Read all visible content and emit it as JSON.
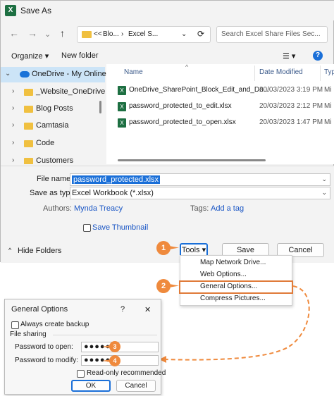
{
  "window": {
    "title": "Save As",
    "app_icon": "excel-icon"
  },
  "nav": {
    "back": "←",
    "forward": "→",
    "recent": "⌄",
    "up": "↑",
    "address": {
      "prefix": "<<",
      "crumb1": "Blo...",
      "sep": "›",
      "crumb2": "Excel S...",
      "chev": "⌄",
      "refresh": "⟳"
    },
    "search_placeholder": "Search Excel Share Files Sec..."
  },
  "toolbar": {
    "organize": "Organize ▾",
    "new_folder": "New folder",
    "view": "☰ ▾",
    "help": "?"
  },
  "sidebar": {
    "items": [
      {
        "label": "OneDrive - My Online",
        "chev": "⌄",
        "selected": true
      },
      {
        "label": "_Website_OneDrive",
        "chev": "›"
      },
      {
        "label": "Blog Posts",
        "chev": "›"
      },
      {
        "label": "Camtasia",
        "chev": "›"
      },
      {
        "label": "Code",
        "chev": "›"
      },
      {
        "label": "Customers",
        "chev": "›"
      }
    ]
  },
  "files": {
    "columns": {
      "name": "Name",
      "date": "Date Modified",
      "type": "Typ",
      "sort_caret": "^"
    },
    "rows": [
      {
        "name": "OneDrive_SharePoint_Block_Edit_and_Do...",
        "date": "20/03/2023 3:19 PM",
        "type": "Mi"
      },
      {
        "name": "password_protected_to_edit.xlsx",
        "date": "20/03/2023 2:12 PM",
        "type": "Mi"
      },
      {
        "name": "password_protected_to_open.xlsx",
        "date": "20/03/2023 1:47 PM",
        "type": "Mi"
      }
    ]
  },
  "form": {
    "file_name_label": "File name:",
    "file_name_value": "password_protected.xlsx",
    "save_type_label": "Save as type:",
    "save_type_value": "Excel Workbook (*.xlsx)",
    "authors_label": "Authors:",
    "authors_value": "Mynda Treacy",
    "tags_label": "Tags:",
    "tags_value": "Add a tag",
    "thumbnail_label": "Save Thumbnail",
    "hide_folders": "Hide Folders",
    "hide_chev": "^",
    "tools": "Tools ▾",
    "save": "Save",
    "cancel": "Cancel"
  },
  "tools_menu": {
    "items": [
      "Map Network Drive...",
      "Web Options...",
      "General Options...",
      "Compress Pictures..."
    ]
  },
  "markers": [
    "1",
    "2",
    "3",
    "4"
  ],
  "general_options": {
    "title": "General Options",
    "help": "?",
    "close": "✕",
    "backup": "Always create backup",
    "sharing": "File sharing",
    "open_label": "Password to open:",
    "open_value": "●●●●●",
    "modify_label": "Password to modify:",
    "modify_value": "●●●●●",
    "readonly": "Read-only recommended",
    "ok": "OK",
    "cancel": "Cancel"
  },
  "colors": {
    "accent": "#1a6fd8",
    "annotation": "#ef8a3d",
    "highlight_box": "#e07b39"
  }
}
